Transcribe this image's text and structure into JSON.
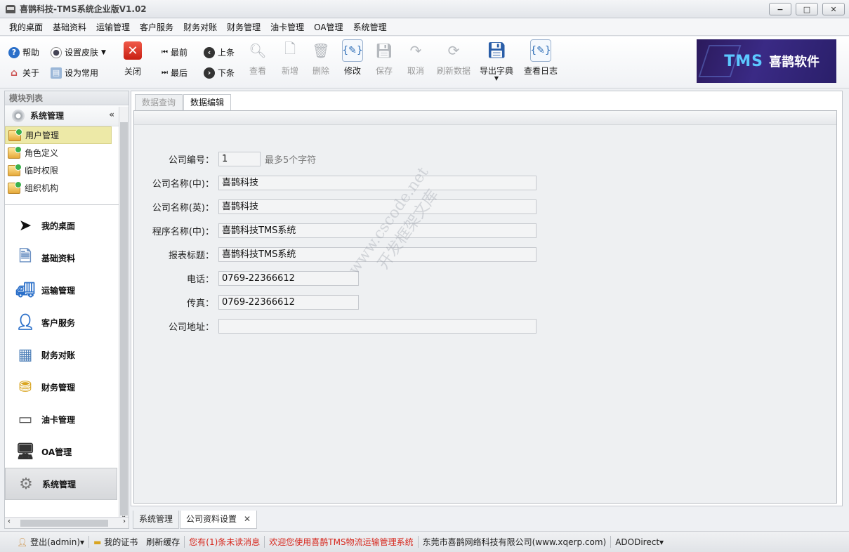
{
  "window": {
    "title": "喜鹊科技-TMS系统企业版V1.02",
    "min": "−",
    "max": "□",
    "close": "✕"
  },
  "menu": [
    "我的桌面",
    "基础资料",
    "运输管理",
    "客户服务",
    "财务对账",
    "财务管理",
    "油卡管理",
    "OA管理",
    "系统管理"
  ],
  "toolbar": {
    "help": "帮助",
    "skin": "设置皮肤",
    "about": "关于",
    "set_common": "设为常用",
    "close": "关闭",
    "first": "最前",
    "last": "最后",
    "prev": "上条",
    "next": "下条",
    "view": "查看",
    "add": "新增",
    "delete": "删除",
    "edit": "修改",
    "save": "保存",
    "cancel": "取消",
    "refresh": "刷新数据",
    "export_dict": "导出字典",
    "view_log": "查看日志"
  },
  "banner": {
    "tms": "TMS",
    "brand": "喜鹊软件"
  },
  "left_panel": {
    "header": "模块列表",
    "group": "系统管理",
    "collapse": "«",
    "items": [
      "用户管理",
      "角色定义",
      "临时权限",
      "组织机构"
    ],
    "nav": [
      "我的桌面",
      "基础资料",
      "运输管理",
      "客户服务",
      "财务对账",
      "财务管理",
      "油卡管理",
      "OA管理",
      "系统管理"
    ],
    "scroll_left": "‹",
    "scroll_right": "›",
    "scroll_down": "⌄"
  },
  "tabs": [
    "数据查询",
    "数据编辑"
  ],
  "form": {
    "company_no": {
      "label": "公司编号：",
      "value": "1",
      "hint": "最多5个字符"
    },
    "company_name_cn": {
      "label": "公司名称(中)：",
      "value": "喜鹊科技"
    },
    "company_name_en": {
      "label": "公司名称(英)：",
      "value": "喜鹊科技"
    },
    "program_name_cn": {
      "label": "程序名称(中)：",
      "value": "喜鹊科技TMS系统"
    },
    "report_title": {
      "label": "报表标题：",
      "value": "喜鹊科技TMS系统"
    },
    "phone": {
      "label": "电话：",
      "value": "0769-22366612"
    },
    "fax": {
      "label": "传真：",
      "value": "0769-22366612"
    },
    "address": {
      "label": "公司地址：",
      "value": ""
    }
  },
  "watermark": {
    "line1": "www.cscode.net",
    "line2": "开发框架文库"
  },
  "bottom_tabs": {
    "tab1": "系统管理",
    "tab2": "公司资料设置",
    "close": "✕"
  },
  "status": {
    "logout": "登出(admin)▾",
    "cert": "我的证书",
    "refresh_cache": "刷新缓存",
    "unread": "您有(1)条未读消息",
    "welcome": "欢迎您使用喜鹊TMS物流运输管理系统",
    "company": "东莞市喜鹊网络科技有限公司(www.xqerp.com)",
    "db": "ADODirect▾"
  },
  "colors": {
    "accent_red": "#d6261c",
    "selected_item": "#ede9a7",
    "banner_bg": "#2b1a5c",
    "banner_tms": "#5cc8ff"
  }
}
